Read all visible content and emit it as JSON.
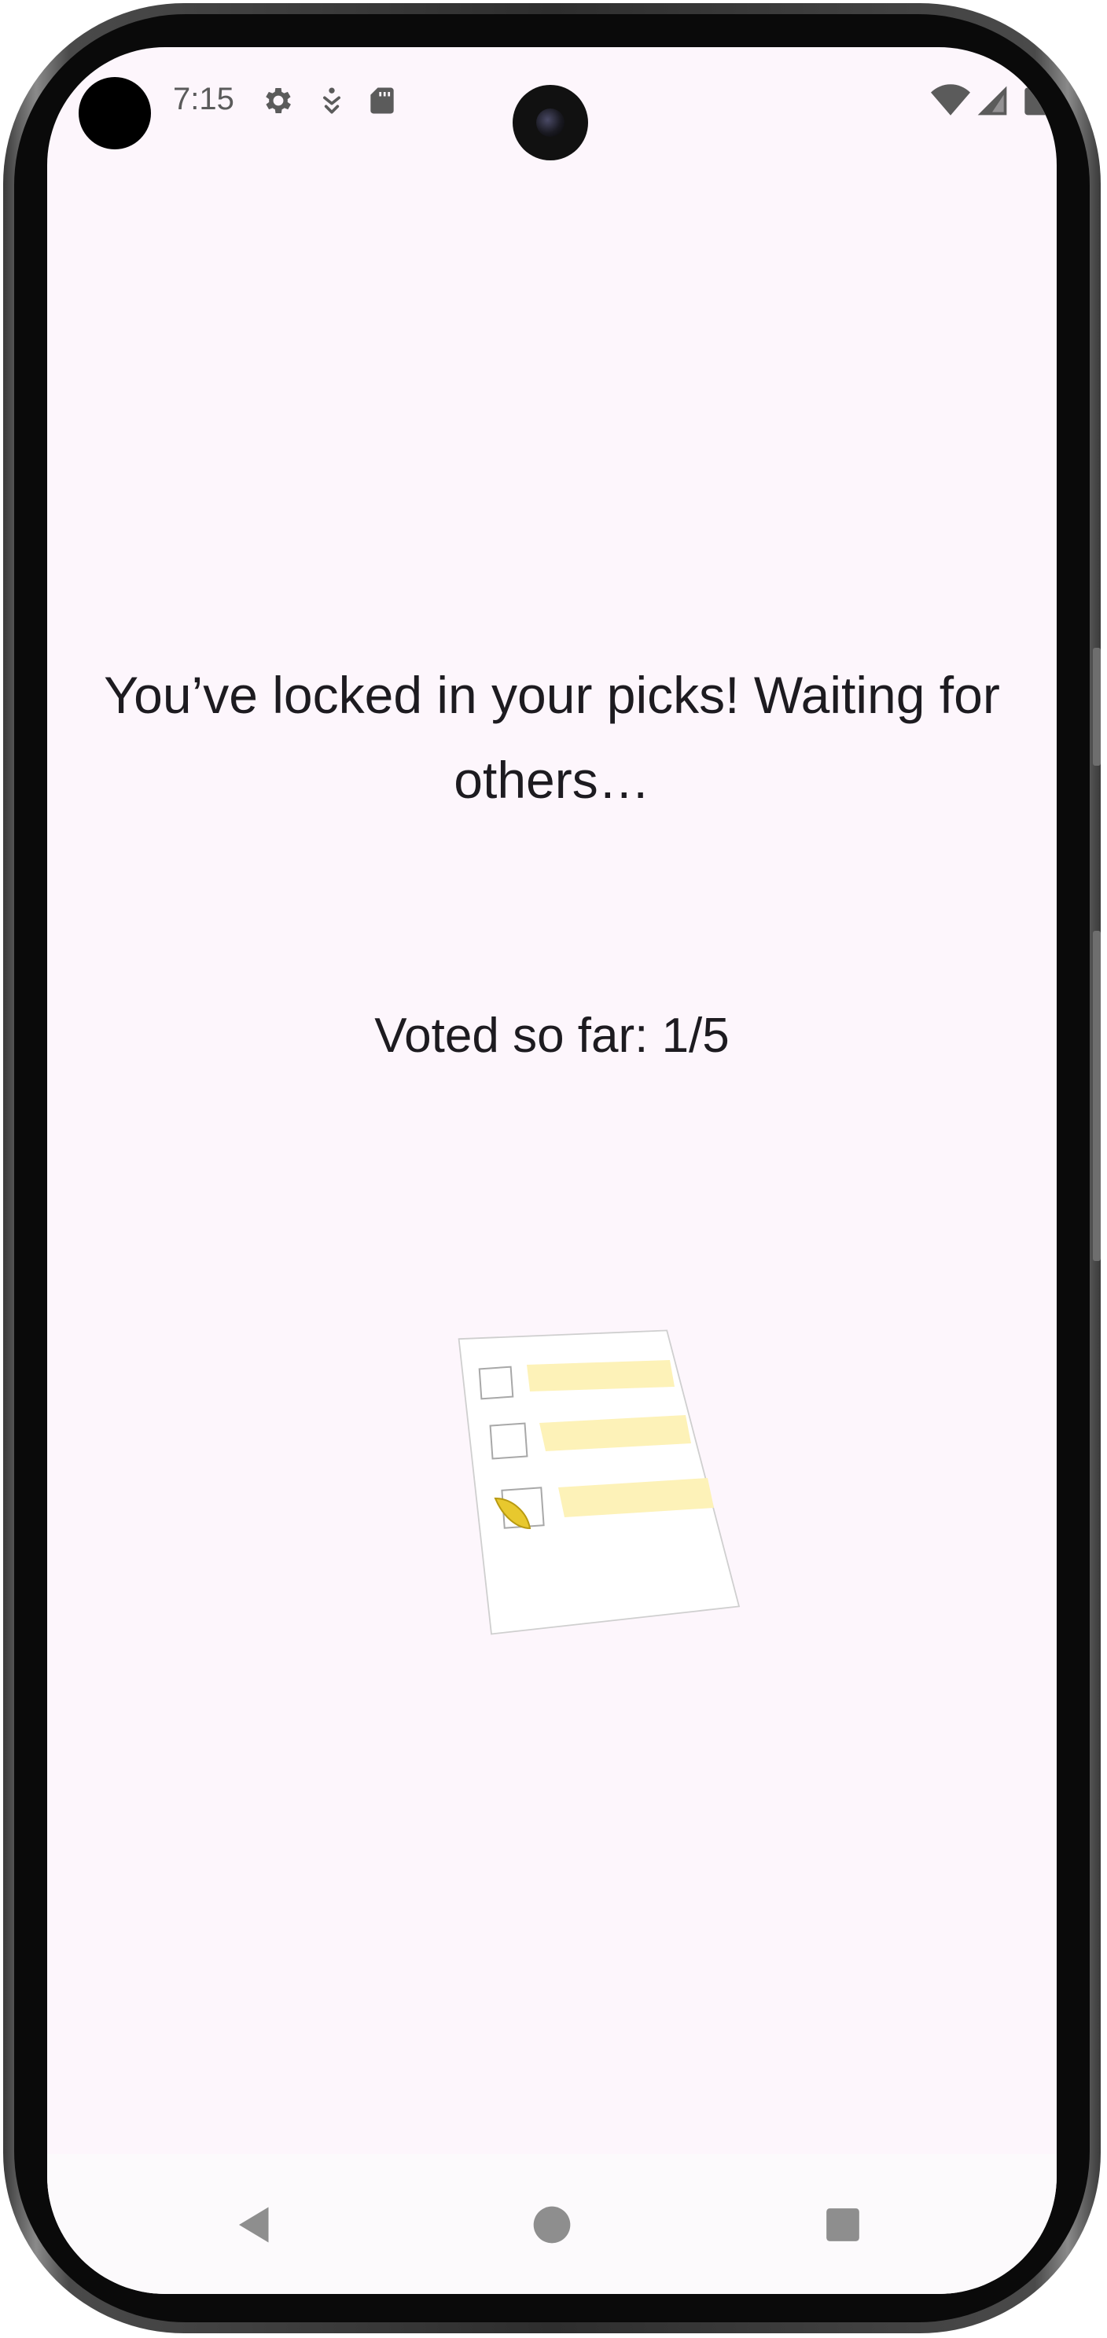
{
  "status_bar": {
    "time": "7:15",
    "icons": [
      "settings-icon",
      "accessibility-download-icon",
      "sd-card-icon",
      "wifi-icon",
      "cell-signal-icon",
      "battery-icon"
    ]
  },
  "main": {
    "message": "You’ve locked in your picks! Waiting for others…",
    "vote_counter": "Voted so far: 1/5"
  },
  "illustration": {
    "semantic": "ballot-checklist-illustration",
    "highlight_color": "#fdf2b8",
    "check_color": "#e8c82e"
  },
  "nav_bar": {
    "buttons": [
      "back-icon",
      "home-icon",
      "recents-icon"
    ]
  },
  "colors": {
    "background": "#fdf6fc",
    "text": "#1d1b20"
  }
}
